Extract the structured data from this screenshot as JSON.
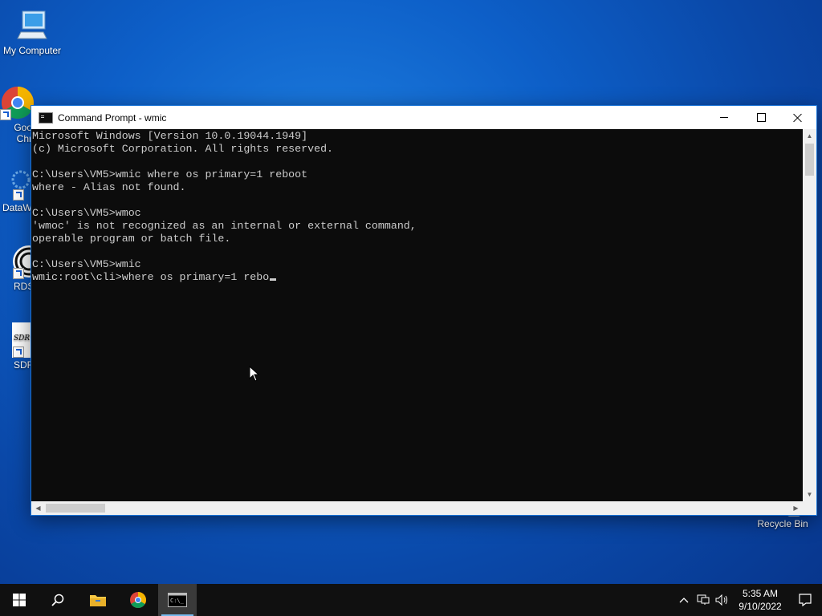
{
  "desktop": {
    "icons": [
      {
        "label": "My Computer"
      },
      {
        "label": "Goo\nChr"
      },
      {
        "label": "DataW"
      },
      {
        "label": "RDS"
      },
      {
        "label": "SDR"
      },
      {
        "label": "Recycle Bin"
      }
    ]
  },
  "window": {
    "title": "Command Prompt - wmic",
    "console_text": "Microsoft Windows [Version 10.0.19044.1949]\n(c) Microsoft Corporation. All rights reserved.\n\nC:\\Users\\VM5>wmic where os primary=1 reboot\nwhere - Alias not found.\n\nC:\\Users\\VM5>wmoc\n'wmoc' is not recognized as an internal or external command,\noperable program or batch file.\n\nC:\\Users\\VM5>wmic\nwmic:root\\cli>where os primary=1 rebo"
  },
  "taskbar": {
    "time": "5:35 AM",
    "date": "9/10/2022"
  },
  "colors": {
    "console_bg": "#0c0c0c",
    "console_fg": "#cccccc",
    "taskbar_bg": "#101010",
    "accent": "#76b9ed"
  },
  "icons": [
    "computer-icon",
    "chrome-icon",
    "datawarehouse-icon",
    "rds-icon",
    "sdr-icon",
    "recycle-bin-icon",
    "windows-start-icon",
    "search-icon",
    "file-explorer-icon",
    "cmd-icon",
    "chevron-up-icon",
    "network-icon",
    "volume-icon",
    "notification-icon"
  ]
}
